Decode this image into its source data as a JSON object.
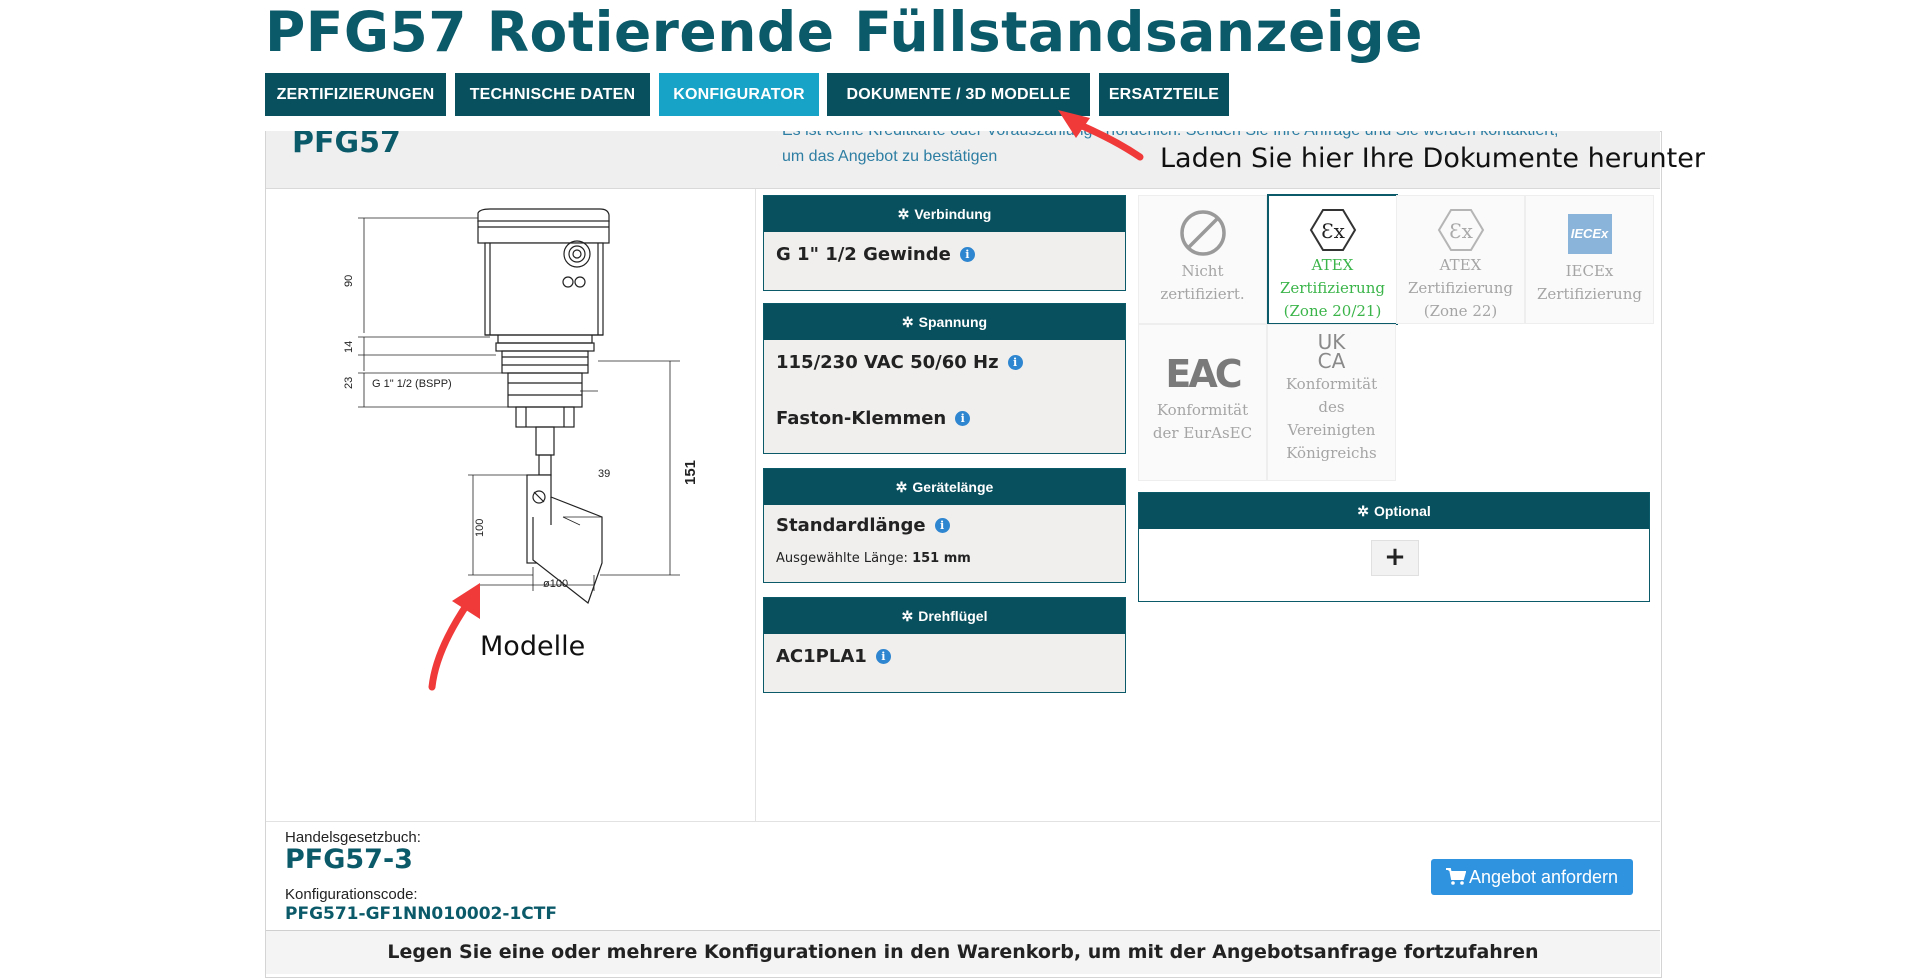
{
  "page": {
    "title": "PFG57 Rotierende Füllstandsanzeige"
  },
  "tabs": [
    {
      "label": "ZERTIFIZIERUNGEN"
    },
    {
      "label": "TECHNISCHE DATEN"
    },
    {
      "label": "KONFIGURATOR",
      "active": true
    },
    {
      "label": "DOKUMENTE / 3D MODELLE"
    },
    {
      "label": "ERSATZTEILE"
    }
  ],
  "product": {
    "name": "PFG57",
    "note_line1": "Es ist keine Kreditkarte oder Vorauszahlung erforderlich. Senden Sie Ihre Anfrage und Sie werden kontaktiert,",
    "note_line2": "um das Angebot zu bestätigen"
  },
  "drawing": {
    "dim_90": "90",
    "dim_14": "14",
    "dim_23": "23",
    "thread": "G 1\" 1/2 (BSPP)",
    "dim_151": "151",
    "dim_39": "39",
    "dim_100": "100",
    "dia_100": "ø100"
  },
  "config": {
    "verbindung": {
      "header": "Verbindung",
      "option": "G 1\" 1/2 Gewinde"
    },
    "spannung": {
      "header": "Spannung",
      "option1": "115/230 VAC 50/60 Hz",
      "option2": "Faston-Klemmen"
    },
    "geraetelaenge": {
      "header": "Gerätelänge",
      "option": "Standardlänge",
      "length_label": "Ausgewählte Länge:",
      "length_value": "151 mm"
    },
    "drehfluegel": {
      "header": "Drehflügel",
      "option": "AC1PLA1"
    }
  },
  "certifications": [
    {
      "icon": "prohibited-icon",
      "lines": [
        "Nicht",
        "zertifiziert."
      ],
      "selected": false
    },
    {
      "icon": "atex-icon",
      "lines": [
        "ATEX",
        "Zertifizierung",
        "(Zone 20/21)"
      ],
      "selected": true
    },
    {
      "icon": "atex-icon",
      "lines": [
        "ATEX",
        "Zertifizierung",
        "(Zone 22)"
      ],
      "selected": false
    },
    {
      "icon": "iecex-icon",
      "icon_text": "IECEx",
      "lines": [
        "IECEx",
        "Zertifizierung"
      ],
      "selected": false
    },
    {
      "icon": "eac-icon",
      "icon_text": "EAC",
      "lines": [
        "Konformität",
        "der EurAsEC"
      ],
      "selected": false
    },
    {
      "icon": "ukca-icon",
      "icon_text_top": "UK",
      "icon_text_bottom": "CA",
      "lines": [
        "Konformität",
        "des",
        "Vereinigten",
        "Königreichs"
      ],
      "selected": false
    }
  ],
  "optional": {
    "header": "Optional",
    "add_label": "+"
  },
  "summary": {
    "model_label": "Handelsgesetzbuch:",
    "model_code": "PFG57-3",
    "config_label": "Konfigurationscode:",
    "config_code": "PFG571-GF1NN010002-1CTF",
    "quote_button": "Angebot anfordern"
  },
  "footer": {
    "message": "Legen Sie eine oder mehrere Konfigurationen in den Warenkorb, um mit der Angebotsanfrage fortzufahren"
  },
  "annotations": {
    "documents_hint": "Laden Sie hier Ihre Dokumente herunter",
    "models_hint": "Modelle",
    "arrow_color": "#f03a3a"
  },
  "colors": {
    "brand": "#0b5a6a",
    "tab_active": "#16a3c7",
    "cert_selected": "#3bb54a",
    "button": "#2f93e0"
  }
}
